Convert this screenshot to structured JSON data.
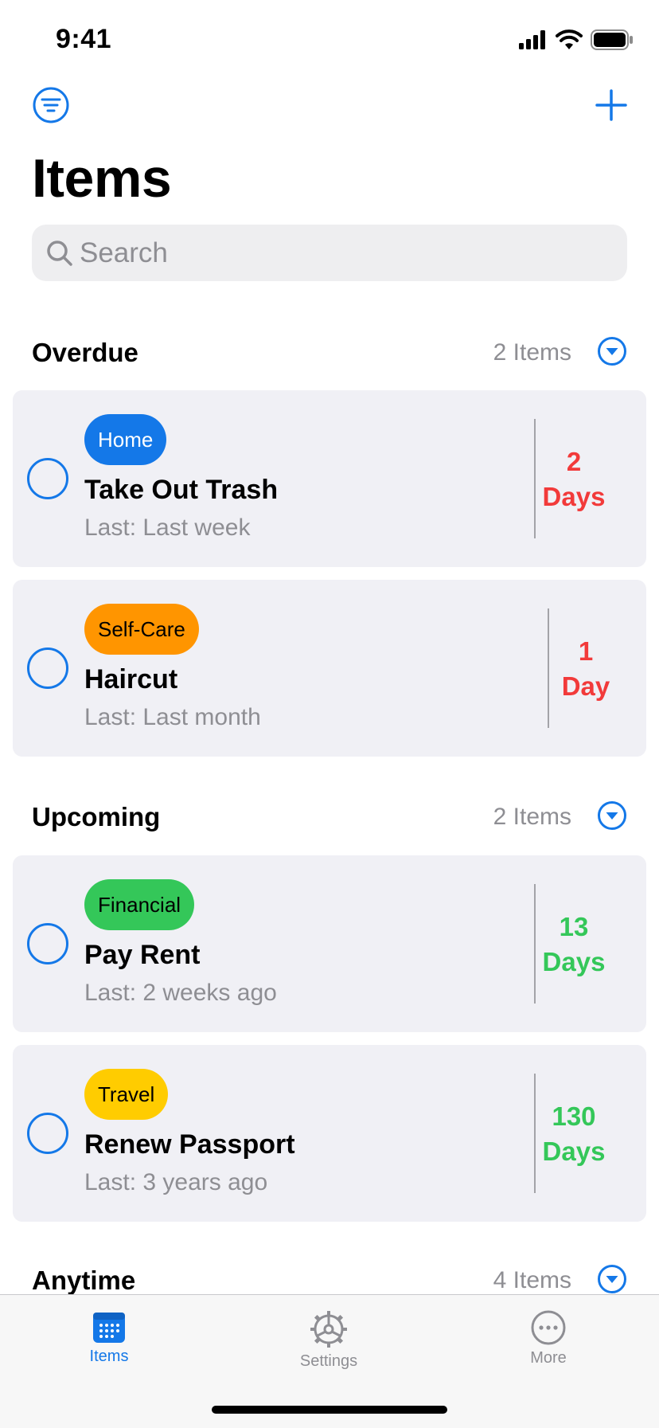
{
  "status_bar": {
    "time": "9:41"
  },
  "nav": {
    "filter_icon": "filter-lines-icon",
    "add_icon": "plus-icon"
  },
  "page": {
    "title": "Items"
  },
  "search": {
    "placeholder": "Search",
    "value": ""
  },
  "colors": {
    "accent": "#1478e8",
    "overdue": "#f23a3a",
    "upcoming": "#34c759",
    "card_bg": "#f0f0f5",
    "secondary_text": "#8e8e93"
  },
  "sections": [
    {
      "title": "Overdue",
      "count": "2 Items",
      "items": [
        {
          "tag": "Home",
          "tag_color": "#1478e8",
          "tag_text_color": "#ffffff",
          "title": "Take Out Trash",
          "last": "Last: Last week",
          "due_number": "2",
          "due_unit": "Days",
          "due_color": "#f23a3a"
        },
        {
          "tag": "Self-Care",
          "tag_color": "#ff9500",
          "tag_text_color": "#000000",
          "title": "Haircut",
          "last": "Last: Last month",
          "due_number": "1",
          "due_unit": "Day",
          "due_color": "#f23a3a"
        }
      ]
    },
    {
      "title": "Upcoming",
      "count": "2 Items",
      "items": [
        {
          "tag": "Financial",
          "tag_color": "#34c759",
          "tag_text_color": "#000000",
          "title": "Pay Rent",
          "last": "Last: 2 weeks ago",
          "due_number": "13",
          "due_unit": "Days",
          "due_color": "#34c759"
        },
        {
          "tag": "Travel",
          "tag_color": "#ffcc00",
          "tag_text_color": "#000000",
          "title": "Renew Passport",
          "last": "Last: 3 years ago",
          "due_number": "130",
          "due_unit": "Days",
          "due_color": "#34c759"
        }
      ]
    },
    {
      "title": "Anytime",
      "count": "4 Items",
      "items": []
    }
  ],
  "tab_bar": {
    "tabs": [
      {
        "label": "Items",
        "icon": "calendar-icon",
        "active": true
      },
      {
        "label": "Settings",
        "icon": "gear-icon",
        "active": false
      },
      {
        "label": "More",
        "icon": "ellipsis-circle-icon",
        "active": false
      }
    ]
  }
}
